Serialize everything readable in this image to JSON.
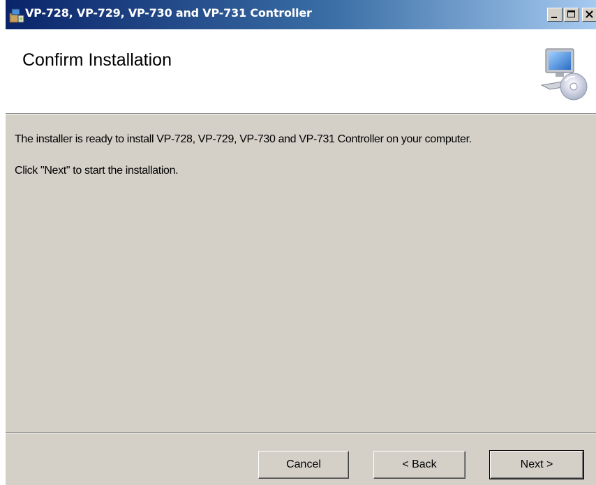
{
  "window": {
    "title": "VP-728, VP-729, VP-730 and VP-731 Controller"
  },
  "header": {
    "title": "Confirm Installation"
  },
  "body": {
    "line1": "The installer is ready to install VP-728, VP-729, VP-730 and VP-731 Controller on your computer.",
    "line2": "Click \"Next\" to start the installation."
  },
  "buttons": {
    "cancel": "Cancel",
    "back": "< Back",
    "next": "Next >"
  },
  "colors": {
    "titlebar_start": "#0a246a",
    "titlebar_end": "#a6caf0",
    "dialog_bg": "#d4d0c8"
  }
}
